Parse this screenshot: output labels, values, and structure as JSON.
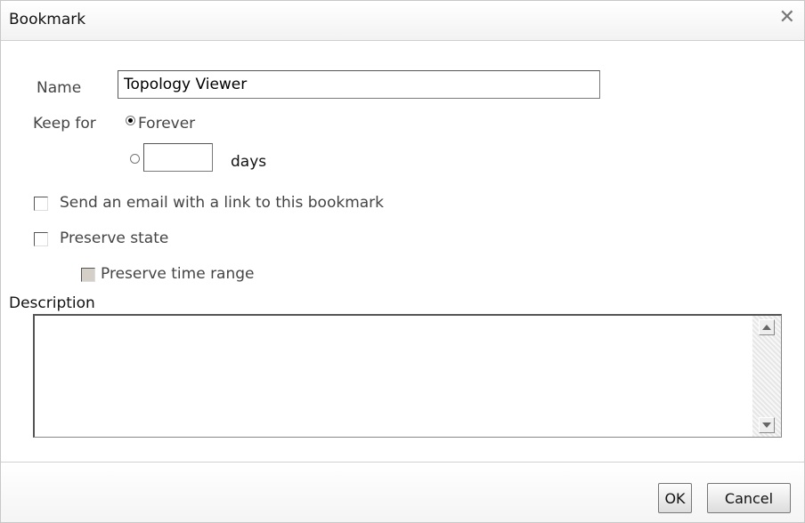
{
  "dialog": {
    "title": "Bookmark",
    "close_icon": "close-icon"
  },
  "form": {
    "name_label": "Name",
    "name_value": "Topology Viewer",
    "keep_for_label": "Keep for",
    "forever_label": "Forever",
    "forever_selected": true,
    "days_value": "",
    "days_label": "days",
    "send_email_label": "Send an email with a link to this bookmark",
    "send_email_checked": false,
    "preserve_state_label": "Preserve state",
    "preserve_state_checked": false,
    "preserve_time_range_label": "Preserve time range",
    "preserve_time_range_disabled": true,
    "description_label": "Description",
    "description_value": ""
  },
  "buttons": {
    "ok_label": "OK",
    "cancel_label": "Cancel"
  }
}
